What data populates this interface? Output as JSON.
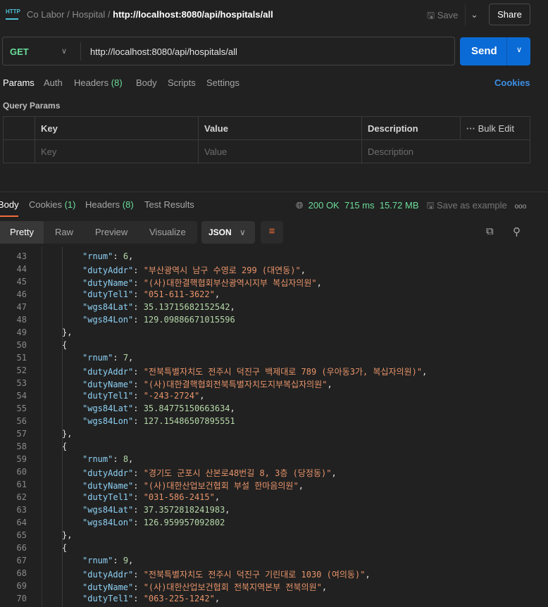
{
  "header": {
    "breadcrumb": [
      "Co Labor",
      "Hospital"
    ],
    "title": "http://localhost:8080/api/hospitals/all",
    "save": "Save",
    "share": "Share"
  },
  "request": {
    "method": "GET",
    "url": "http://localhost:8080/api/hospitals/all",
    "send": "Send"
  },
  "req_tabs": {
    "params": "Params",
    "auth": "Auth",
    "headers": "Headers",
    "headers_count": "(8)",
    "body": "Body",
    "scripts": "Scripts",
    "settings": "Settings",
    "cookies": "Cookies"
  },
  "query_params": {
    "title": "Query Params",
    "columns": [
      "Key",
      "Value",
      "Description"
    ],
    "bulk_edit": "Bulk Edit",
    "placeholders": [
      "Key",
      "Value",
      "Description"
    ]
  },
  "response": {
    "tabs": {
      "body": "Body",
      "cookies": "Cookies",
      "cookies_count": "(1)",
      "headers": "Headers",
      "headers_count": "(8)",
      "test_results": "Test Results"
    },
    "status": "200 OK",
    "time": "715 ms",
    "size": "15.72 MB",
    "save_example": "Save as example",
    "views": [
      "Pretty",
      "Raw",
      "Preview",
      "Visualize"
    ],
    "format": "JSON"
  },
  "colors": {
    "accent": "#f26b3a",
    "send": "#0b6bd6",
    "green": "#6bdd9a"
  },
  "code_lines": [
    {
      "n": "43",
      "i": 2,
      "k": "rnum",
      "v": "6",
      "t": "n",
      "c": ","
    },
    {
      "n": "44",
      "i": 2,
      "k": "dutyAddr",
      "v": "\"부산광역시 남구 수영로 299 (대연동)\"",
      "t": "s",
      "c": ","
    },
    {
      "n": "45",
      "i": 2,
      "k": "dutyName",
      "v": "\"(사)대한결핵협회부산광역시지부 복십자의원\"",
      "t": "s",
      "c": ","
    },
    {
      "n": "46",
      "i": 2,
      "k": "dutyTel1",
      "v": "\"051-611-3622\"",
      "t": "s",
      "c": ","
    },
    {
      "n": "47",
      "i": 2,
      "k": "wgs84Lat",
      "v": "35.13715682152542",
      "t": "n",
      "c": ","
    },
    {
      "n": "48",
      "i": 2,
      "k": "wgs84Lon",
      "v": "129.09886671015596",
      "t": "n",
      "c": ""
    },
    {
      "n": "49",
      "i": 1,
      "p": "},"
    },
    {
      "n": "50",
      "i": 1,
      "p": "{"
    },
    {
      "n": "51",
      "i": 2,
      "k": "rnum",
      "v": "7",
      "t": "n",
      "c": ","
    },
    {
      "n": "52",
      "i": 2,
      "k": "dutyAddr",
      "v": "\"전북특별자치도 전주시 덕진구 백제대로 789 (우아동3가, 복십자의원)\"",
      "t": "s",
      "c": ","
    },
    {
      "n": "53",
      "i": 2,
      "k": "dutyName",
      "v": "\"(사)대한결핵협회전북특별자치도지부복십자의원\"",
      "t": "s",
      "c": ","
    },
    {
      "n": "54",
      "i": 2,
      "k": "dutyTel1",
      "v": "\"-243-2724\"",
      "t": "s",
      "c": ","
    },
    {
      "n": "55",
      "i": 2,
      "k": "wgs84Lat",
      "v": "35.84775150663634",
      "t": "n",
      "c": ","
    },
    {
      "n": "56",
      "i": 2,
      "k": "wgs84Lon",
      "v": "127.15486507895551",
      "t": "n",
      "c": ""
    },
    {
      "n": "57",
      "i": 1,
      "p": "},"
    },
    {
      "n": "58",
      "i": 1,
      "p": "{"
    },
    {
      "n": "59",
      "i": 2,
      "k": "rnum",
      "v": "8",
      "t": "n",
      "c": ","
    },
    {
      "n": "60",
      "i": 2,
      "k": "dutyAddr",
      "v": "\"경기도 군포시 산본로48번길 8, 3층 (당정동)\"",
      "t": "s",
      "c": ","
    },
    {
      "n": "61",
      "i": 2,
      "k": "dutyName",
      "v": "\"(사)대한산업보건협회 부설 한마음의원\"",
      "t": "s",
      "c": ","
    },
    {
      "n": "62",
      "i": 2,
      "k": "dutyTel1",
      "v": "\"031-586-2415\"",
      "t": "s",
      "c": ","
    },
    {
      "n": "63",
      "i": 2,
      "k": "wgs84Lat",
      "v": "37.3572818241983",
      "t": "n",
      "c": ","
    },
    {
      "n": "64",
      "i": 2,
      "k": "wgs84Lon",
      "v": "126.959957092802",
      "t": "n",
      "c": ""
    },
    {
      "n": "65",
      "i": 1,
      "p": "},"
    },
    {
      "n": "66",
      "i": 1,
      "p": "{"
    },
    {
      "n": "67",
      "i": 2,
      "k": "rnum",
      "v": "9",
      "t": "n",
      "c": ","
    },
    {
      "n": "68",
      "i": 2,
      "k": "dutyAddr",
      "v": "\"전북특별자치도 전주시 덕진구 기린대로 1030 (여의동)\"",
      "t": "s",
      "c": ","
    },
    {
      "n": "69",
      "i": 2,
      "k": "dutyName",
      "v": "\"(사)대한산업보건협회 전북지역본부 전북의원\"",
      "t": "s",
      "c": ","
    },
    {
      "n": "70",
      "i": 2,
      "k": "dutyTel1",
      "v": "\"063-225-1242\"",
      "t": "s",
      "c": ","
    }
  ]
}
